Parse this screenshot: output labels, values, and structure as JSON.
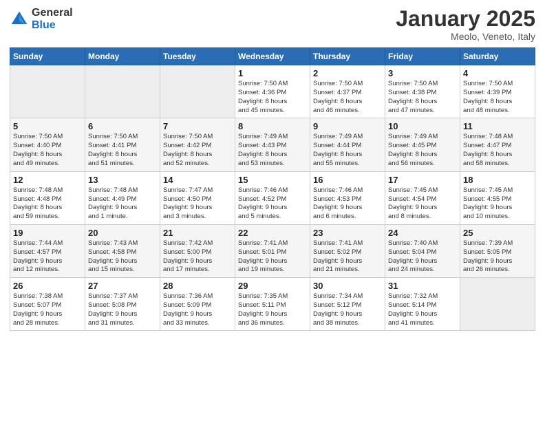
{
  "header": {
    "logo_general": "General",
    "logo_blue": "Blue",
    "month_title": "January 2025",
    "subtitle": "Meolo, Veneto, Italy"
  },
  "weekdays": [
    "Sunday",
    "Monday",
    "Tuesday",
    "Wednesday",
    "Thursday",
    "Friday",
    "Saturday"
  ],
  "weeks": [
    [
      {
        "day": "",
        "info": ""
      },
      {
        "day": "",
        "info": ""
      },
      {
        "day": "",
        "info": ""
      },
      {
        "day": "1",
        "info": "Sunrise: 7:50 AM\nSunset: 4:36 PM\nDaylight: 8 hours\nand 45 minutes."
      },
      {
        "day": "2",
        "info": "Sunrise: 7:50 AM\nSunset: 4:37 PM\nDaylight: 8 hours\nand 46 minutes."
      },
      {
        "day": "3",
        "info": "Sunrise: 7:50 AM\nSunset: 4:38 PM\nDaylight: 8 hours\nand 47 minutes."
      },
      {
        "day": "4",
        "info": "Sunrise: 7:50 AM\nSunset: 4:39 PM\nDaylight: 8 hours\nand 48 minutes."
      }
    ],
    [
      {
        "day": "5",
        "info": "Sunrise: 7:50 AM\nSunset: 4:40 PM\nDaylight: 8 hours\nand 49 minutes."
      },
      {
        "day": "6",
        "info": "Sunrise: 7:50 AM\nSunset: 4:41 PM\nDaylight: 8 hours\nand 51 minutes."
      },
      {
        "day": "7",
        "info": "Sunrise: 7:50 AM\nSunset: 4:42 PM\nDaylight: 8 hours\nand 52 minutes."
      },
      {
        "day": "8",
        "info": "Sunrise: 7:49 AM\nSunset: 4:43 PM\nDaylight: 8 hours\nand 53 minutes."
      },
      {
        "day": "9",
        "info": "Sunrise: 7:49 AM\nSunset: 4:44 PM\nDaylight: 8 hours\nand 55 minutes."
      },
      {
        "day": "10",
        "info": "Sunrise: 7:49 AM\nSunset: 4:45 PM\nDaylight: 8 hours\nand 56 minutes."
      },
      {
        "day": "11",
        "info": "Sunrise: 7:48 AM\nSunset: 4:47 PM\nDaylight: 8 hours\nand 58 minutes."
      }
    ],
    [
      {
        "day": "12",
        "info": "Sunrise: 7:48 AM\nSunset: 4:48 PM\nDaylight: 8 hours\nand 59 minutes."
      },
      {
        "day": "13",
        "info": "Sunrise: 7:48 AM\nSunset: 4:49 PM\nDaylight: 9 hours\nand 1 minute."
      },
      {
        "day": "14",
        "info": "Sunrise: 7:47 AM\nSunset: 4:50 PM\nDaylight: 9 hours\nand 3 minutes."
      },
      {
        "day": "15",
        "info": "Sunrise: 7:46 AM\nSunset: 4:52 PM\nDaylight: 9 hours\nand 5 minutes."
      },
      {
        "day": "16",
        "info": "Sunrise: 7:46 AM\nSunset: 4:53 PM\nDaylight: 9 hours\nand 6 minutes."
      },
      {
        "day": "17",
        "info": "Sunrise: 7:45 AM\nSunset: 4:54 PM\nDaylight: 9 hours\nand 8 minutes."
      },
      {
        "day": "18",
        "info": "Sunrise: 7:45 AM\nSunset: 4:55 PM\nDaylight: 9 hours\nand 10 minutes."
      }
    ],
    [
      {
        "day": "19",
        "info": "Sunrise: 7:44 AM\nSunset: 4:57 PM\nDaylight: 9 hours\nand 12 minutes."
      },
      {
        "day": "20",
        "info": "Sunrise: 7:43 AM\nSunset: 4:58 PM\nDaylight: 9 hours\nand 15 minutes."
      },
      {
        "day": "21",
        "info": "Sunrise: 7:42 AM\nSunset: 5:00 PM\nDaylight: 9 hours\nand 17 minutes."
      },
      {
        "day": "22",
        "info": "Sunrise: 7:41 AM\nSunset: 5:01 PM\nDaylight: 9 hours\nand 19 minutes."
      },
      {
        "day": "23",
        "info": "Sunrise: 7:41 AM\nSunset: 5:02 PM\nDaylight: 9 hours\nand 21 minutes."
      },
      {
        "day": "24",
        "info": "Sunrise: 7:40 AM\nSunset: 5:04 PM\nDaylight: 9 hours\nand 24 minutes."
      },
      {
        "day": "25",
        "info": "Sunrise: 7:39 AM\nSunset: 5:05 PM\nDaylight: 9 hours\nand 26 minutes."
      }
    ],
    [
      {
        "day": "26",
        "info": "Sunrise: 7:38 AM\nSunset: 5:07 PM\nDaylight: 9 hours\nand 28 minutes."
      },
      {
        "day": "27",
        "info": "Sunrise: 7:37 AM\nSunset: 5:08 PM\nDaylight: 9 hours\nand 31 minutes."
      },
      {
        "day": "28",
        "info": "Sunrise: 7:36 AM\nSunset: 5:09 PM\nDaylight: 9 hours\nand 33 minutes."
      },
      {
        "day": "29",
        "info": "Sunrise: 7:35 AM\nSunset: 5:11 PM\nDaylight: 9 hours\nand 36 minutes."
      },
      {
        "day": "30",
        "info": "Sunrise: 7:34 AM\nSunset: 5:12 PM\nDaylight: 9 hours\nand 38 minutes."
      },
      {
        "day": "31",
        "info": "Sunrise: 7:32 AM\nSunset: 5:14 PM\nDaylight: 9 hours\nand 41 minutes."
      },
      {
        "day": "",
        "info": ""
      }
    ]
  ]
}
